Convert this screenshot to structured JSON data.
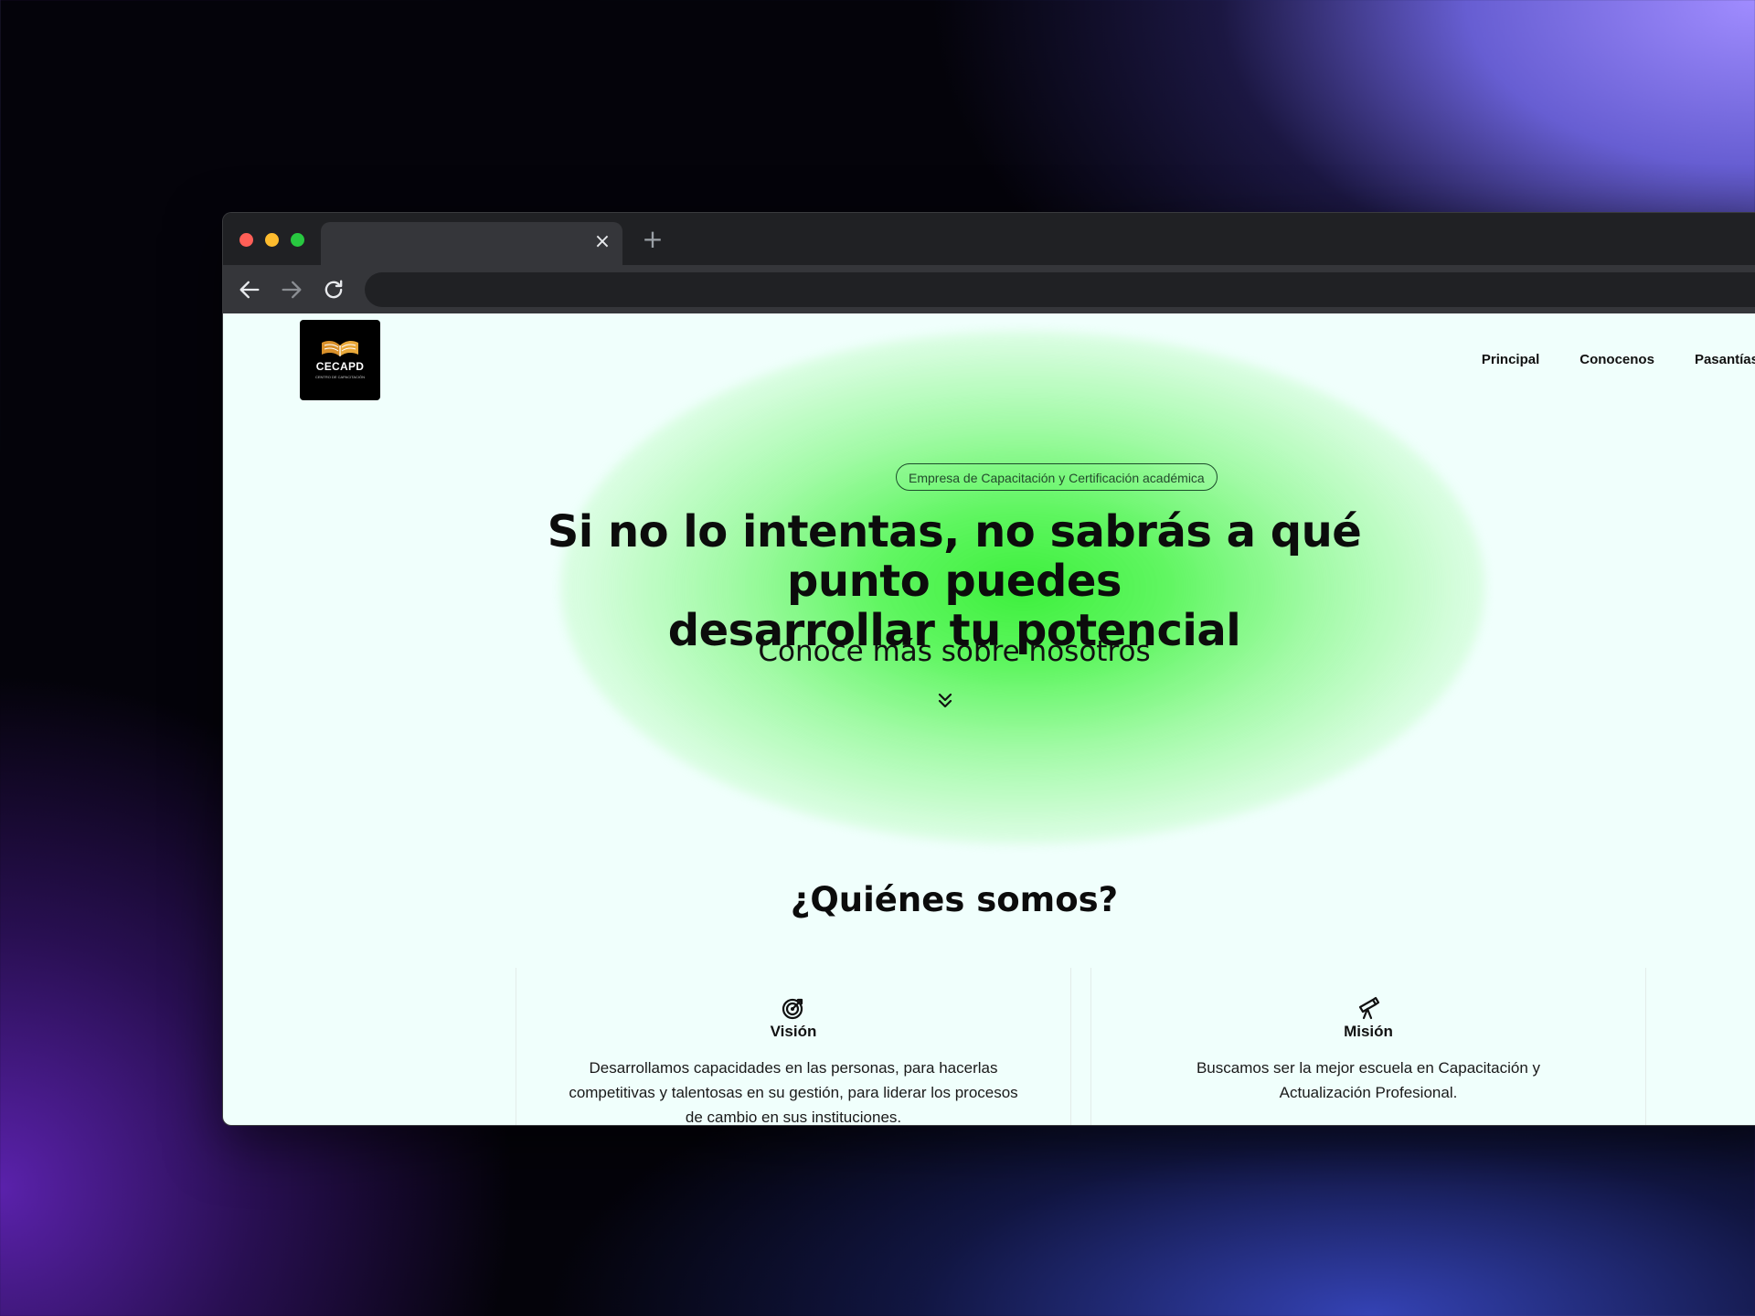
{
  "browser": {
    "tab_close": "×",
    "new_tab": "+",
    "omnibox_value": ""
  },
  "site": {
    "logo": {
      "text": "CECAPD",
      "subtext": "CENTRO DE CAPACITACIÓN"
    },
    "nav": [
      {
        "label": "Principal"
      },
      {
        "label": "Conocenos"
      },
      {
        "label": "Pasantías"
      }
    ]
  },
  "hero": {
    "badge": "Empresa de Capacitación y Certificación académica",
    "title_line1": "Si no lo intentas, no sabrás a qué punto puedes",
    "title_line2": "desarrollar tu potencial",
    "subtitle": "Conoce más sobre nosotros"
  },
  "about": {
    "title": "¿Quiénes somos?",
    "cards": [
      {
        "icon": "target-icon",
        "title": "Visión",
        "text": "Desarrollamos capacidades en las personas, para hacerlas competitivas y talentosas en su gestión, para liderar los procesos de cambio en sus instituciones."
      },
      {
        "icon": "telescope-icon",
        "title": "Misión",
        "text": "Buscamos ser la mejor escuela en Capacitación y Actualización Profesional."
      }
    ]
  },
  "colors": {
    "page_bg": "#f0fffc",
    "glow_green": "#3cf03c",
    "browser_chrome": "#202124",
    "toolbar": "#35363a"
  }
}
